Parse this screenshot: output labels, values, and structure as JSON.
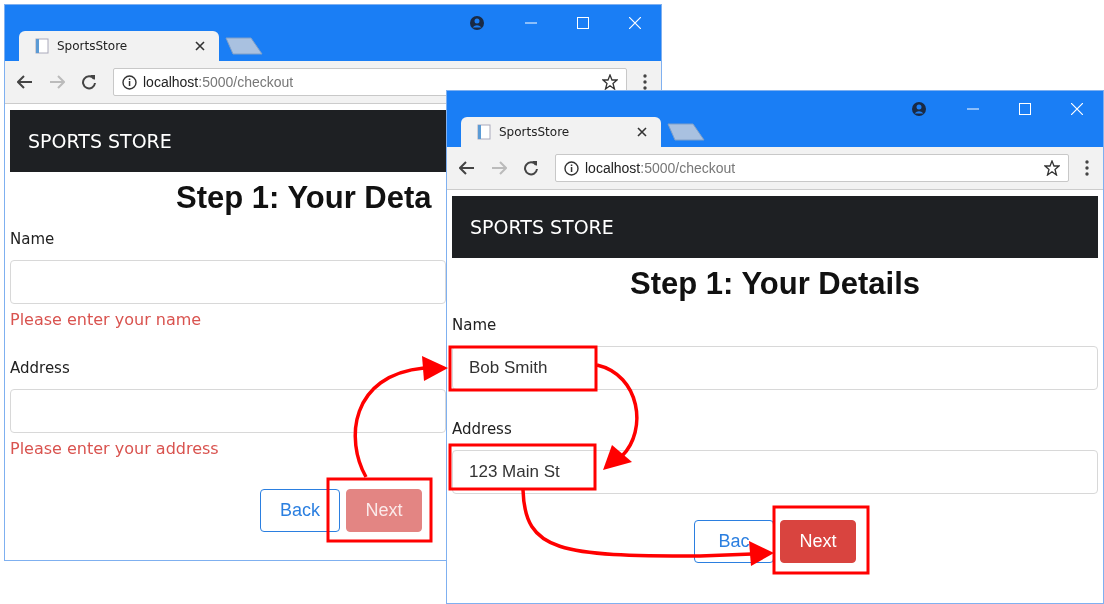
{
  "windows": [
    {
      "tab": {
        "title": "SportsStore"
      },
      "address": {
        "host": "localhost",
        "path": ":5000/checkout"
      },
      "brand": "SPORTS STORE",
      "heading": "Step 1: Your Deta",
      "fields": [
        {
          "label": "Name",
          "error": "Please enter your name"
        },
        {
          "label": "Address",
          "error": "Please enter your address"
        }
      ],
      "buttons": [
        {
          "label": "Back",
          "kind": "outline",
          "disabled": false
        },
        {
          "label": "Next",
          "kind": "primary",
          "disabled": true
        }
      ]
    },
    {
      "tab": {
        "title": "SportsStore"
      },
      "address": {
        "host": "localhost",
        "path": ":5000/checkout"
      },
      "brand": "SPORTS STORE",
      "heading": "Step 1: Your Details",
      "fields": [
        {
          "label": "Name",
          "value": "Bob Smith"
        },
        {
          "label": "Address",
          "value": "123 Main St"
        }
      ],
      "buttons": [
        {
          "label": "Bac",
          "kind": "outline",
          "disabled": false
        },
        {
          "label": "Next",
          "kind": "primary",
          "disabled": false
        }
      ]
    }
  ]
}
